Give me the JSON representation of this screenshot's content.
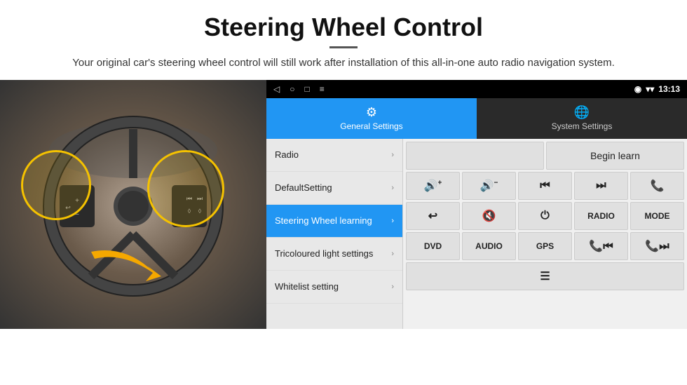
{
  "page": {
    "title": "Steering Wheel Control",
    "subtitle": "Your original car's steering wheel control will still work after installation of this all-in-one auto radio navigation system.",
    "divider": "—"
  },
  "statusbar": {
    "nav_back": "◁",
    "nav_home": "○",
    "nav_recent": "□",
    "nav_menu": "≡",
    "signal_icon": "▾",
    "wifi_icon": "▾",
    "time": "13:13"
  },
  "tabs": {
    "general_label": "General Settings",
    "system_label": "System Settings"
  },
  "menu": {
    "items": [
      {
        "label": "Radio",
        "active": false
      },
      {
        "label": "DefaultSetting",
        "active": false
      },
      {
        "label": "Steering Wheel learning",
        "active": true
      },
      {
        "label": "Tricoloured light settings",
        "active": false
      },
      {
        "label": "Whitelist setting",
        "active": false
      }
    ]
  },
  "controls": {
    "begin_learn": "Begin learn",
    "row2": [
      "🔊+",
      "🔊−",
      "⏮",
      "⏭",
      "📞"
    ],
    "row3": [
      "↩",
      "🔊✕",
      "⏻",
      "RADIO",
      "MODE"
    ],
    "row4": [
      "DVD",
      "AUDIO",
      "GPS",
      "📞⏮",
      "📞⏭"
    ],
    "row5_icon": "≡"
  }
}
